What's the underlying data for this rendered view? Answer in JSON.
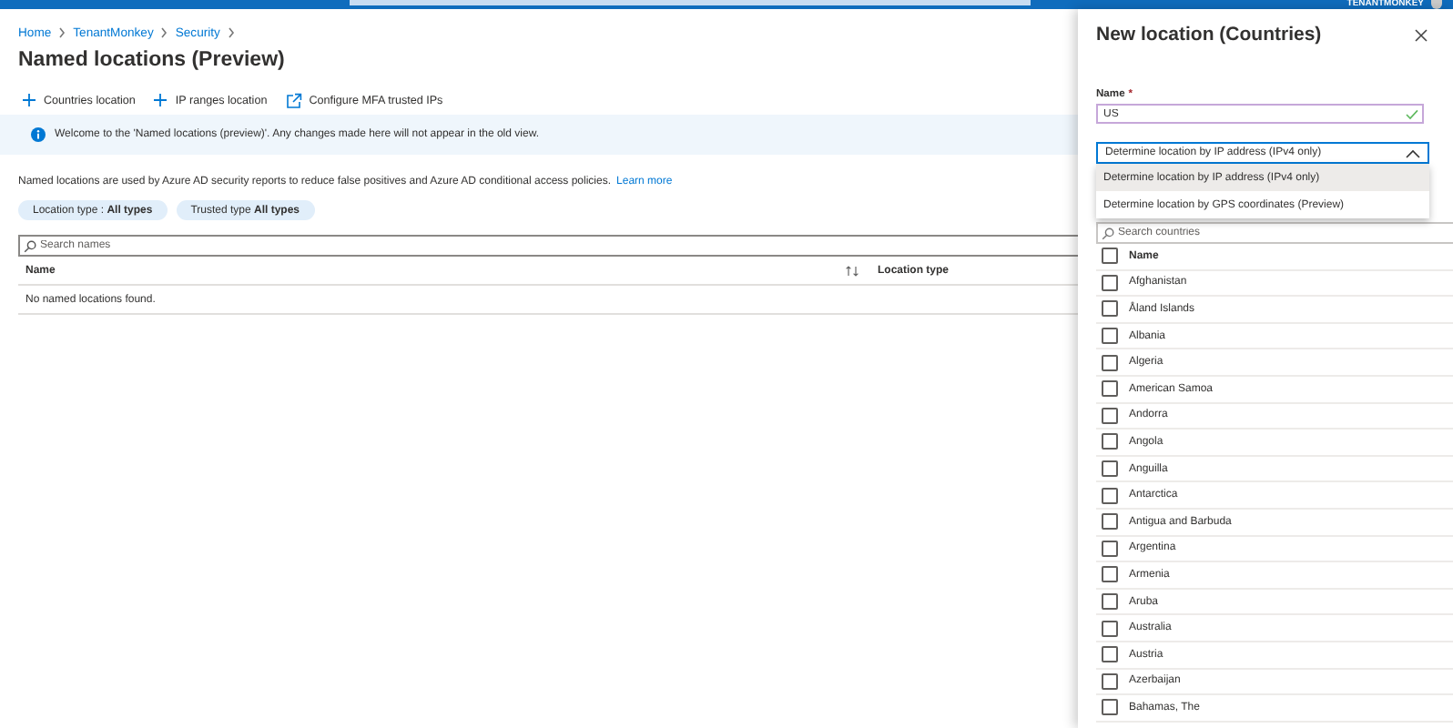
{
  "top_bar": {
    "account": "TENANTMONKEY"
  },
  "breadcrumb": [
    "Home",
    "TenantMonkey",
    "Security"
  ],
  "title": "Named locations (Preview)",
  "toolbar": [
    {
      "kind": "add",
      "label": "Countries location"
    },
    {
      "kind": "add",
      "label": "IP ranges location"
    },
    {
      "kind": "external",
      "label": "Configure MFA trusted IPs"
    }
  ],
  "info_bar": "Welcome to the 'Named locations (preview)'. Any changes made here will not appear in the old view.",
  "description": {
    "text": "Named locations are used by Azure AD security reports to reduce false positives and Azure AD conditional access policies.",
    "link": "Learn more"
  },
  "filters": [
    {
      "label": "Location type :",
      "value": "All types"
    },
    {
      "label": "Trusted type",
      "value": "All types"
    }
  ],
  "search": {
    "placeholder": "Search names"
  },
  "table": {
    "columns": [
      "Name",
      "Location type"
    ],
    "empty_message": "No named locations found."
  },
  "panel": {
    "title": "New location (Countries)",
    "name_field": {
      "label": "Name",
      "required_mark": "*",
      "value": "US",
      "valid": true
    },
    "dropdown": {
      "value": "Determine location by IP address (IPv4 only)",
      "expanded": true,
      "options": [
        {
          "label": "Determine location by IP address (IPv4 only)",
          "selected": true
        },
        {
          "label": "Determine location by GPS coordinates (Preview)",
          "selected": false
        }
      ]
    },
    "country_search": {
      "placeholder": "Search countries"
    },
    "list_header": "Name",
    "list_header_checked": false,
    "countries": [
      {
        "name": "Afghanistan",
        "checked": false
      },
      {
        "name": "Åland Islands",
        "checked": false
      },
      {
        "name": "Albania",
        "checked": false
      },
      {
        "name": "Algeria",
        "checked": false
      },
      {
        "name": "American Samoa",
        "checked": false
      },
      {
        "name": "Andorra",
        "checked": false
      },
      {
        "name": "Angola",
        "checked": false
      },
      {
        "name": "Anguilla",
        "checked": false
      },
      {
        "name": "Antarctica",
        "checked": false
      },
      {
        "name": "Antigua and Barbuda",
        "checked": false
      },
      {
        "name": "Argentina",
        "checked": false
      },
      {
        "name": "Armenia",
        "checked": false
      },
      {
        "name": "Aruba",
        "checked": false
      },
      {
        "name": "Australia",
        "checked": false
      },
      {
        "name": "Austria",
        "checked": false
      },
      {
        "name": "Azerbaijan",
        "checked": false
      },
      {
        "name": "Bahamas, The",
        "checked": false
      }
    ]
  }
}
